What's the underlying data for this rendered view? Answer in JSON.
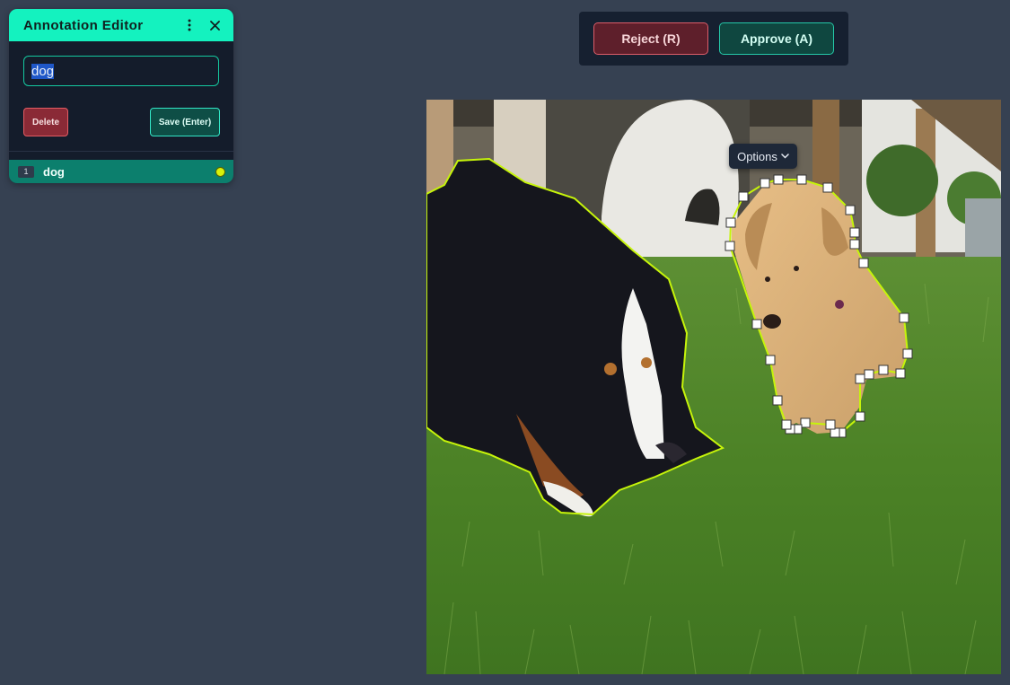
{
  "editor": {
    "title": "Annotation Editor",
    "label_value": "dog",
    "delete_label": "Delete",
    "save_label": "Save (Enter)",
    "annotations": [
      {
        "index": "1",
        "label": "dog",
        "color": "#d8f20b"
      }
    ]
  },
  "review": {
    "reject_label": "Reject (R)",
    "approve_label": "Approve (A)"
  },
  "canvas": {
    "options_label": "Options",
    "polygon_color": "#c6f40a"
  },
  "icons": [
    "kebab-menu-icon",
    "close-icon",
    "chevron-down-icon"
  ]
}
